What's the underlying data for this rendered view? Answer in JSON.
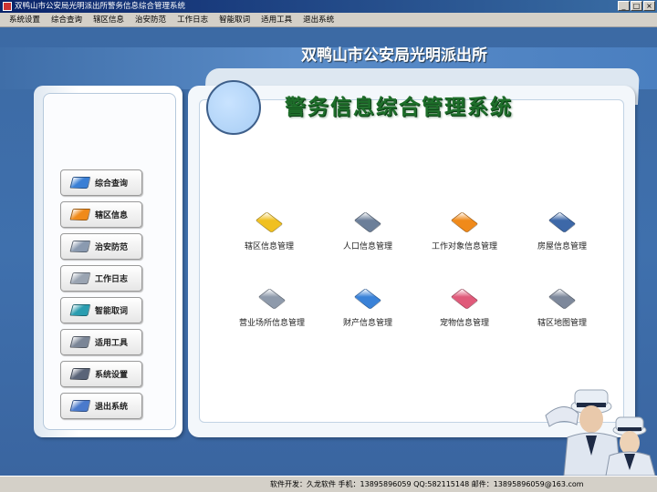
{
  "window": {
    "title": "双鸭山市公安局光明派出所警务信息综合管理系统",
    "min_glyph": "_",
    "max_glyph": "□",
    "close_glyph": "×"
  },
  "menu": [
    "系统设置",
    "综合查询",
    "辖区信息",
    "治安防范",
    "工作日志",
    "智能取词",
    "适用工具",
    "退出系统"
  ],
  "header": {
    "station_name": "双鸭山市公安局光明派出所",
    "system_title": "警务信息综合管理系统"
  },
  "sidebar": [
    {
      "label": "综合查询",
      "icon": "search-icon",
      "color": "#3a7fd5"
    },
    {
      "label": "辖区信息",
      "icon": "broadcast-icon",
      "color": "#f08a1a"
    },
    {
      "label": "治安防范",
      "icon": "security-icon",
      "color": "#8a9ab0"
    },
    {
      "label": "工作日志",
      "icon": "log-icon",
      "color": "#9aa4b2"
    },
    {
      "label": "智能取词",
      "icon": "word-icon",
      "color": "#2a9db0"
    },
    {
      "label": "适用工具",
      "icon": "tools-icon",
      "color": "#7a8596"
    },
    {
      "label": "系统设置",
      "icon": "settings-icon",
      "color": "#5a6478"
    },
    {
      "label": "退出系统",
      "icon": "exit-icon",
      "color": "#4a7acc"
    }
  ],
  "features": [
    {
      "label": "辖区信息管理",
      "icon": "district-info-icon",
      "color": "#f0c020"
    },
    {
      "label": "人口信息管理",
      "icon": "population-icon",
      "color": "#6c7f99"
    },
    {
      "label": "工作对象信息管理",
      "icon": "work-target-icon",
      "color": "#f08a1a"
    },
    {
      "label": "房屋信息管理",
      "icon": "house-icon",
      "color": "#3d68a8"
    },
    {
      "label": "营业场所信息管理",
      "icon": "business-icon",
      "color": "#8e9aab"
    },
    {
      "label": "财产信息管理",
      "icon": "property-icon",
      "color": "#3a82d8"
    },
    {
      "label": "宠物信息管理",
      "icon": "pet-icon",
      "color": "#e05a7a"
    },
    {
      "label": "辖区地图管理",
      "icon": "map-icon",
      "color": "#7d889b"
    }
  ],
  "status": {
    "text": "软件开发：久龙软件  手机：13895896059  QQ:582115148  邮件：13895896059@163.com"
  }
}
